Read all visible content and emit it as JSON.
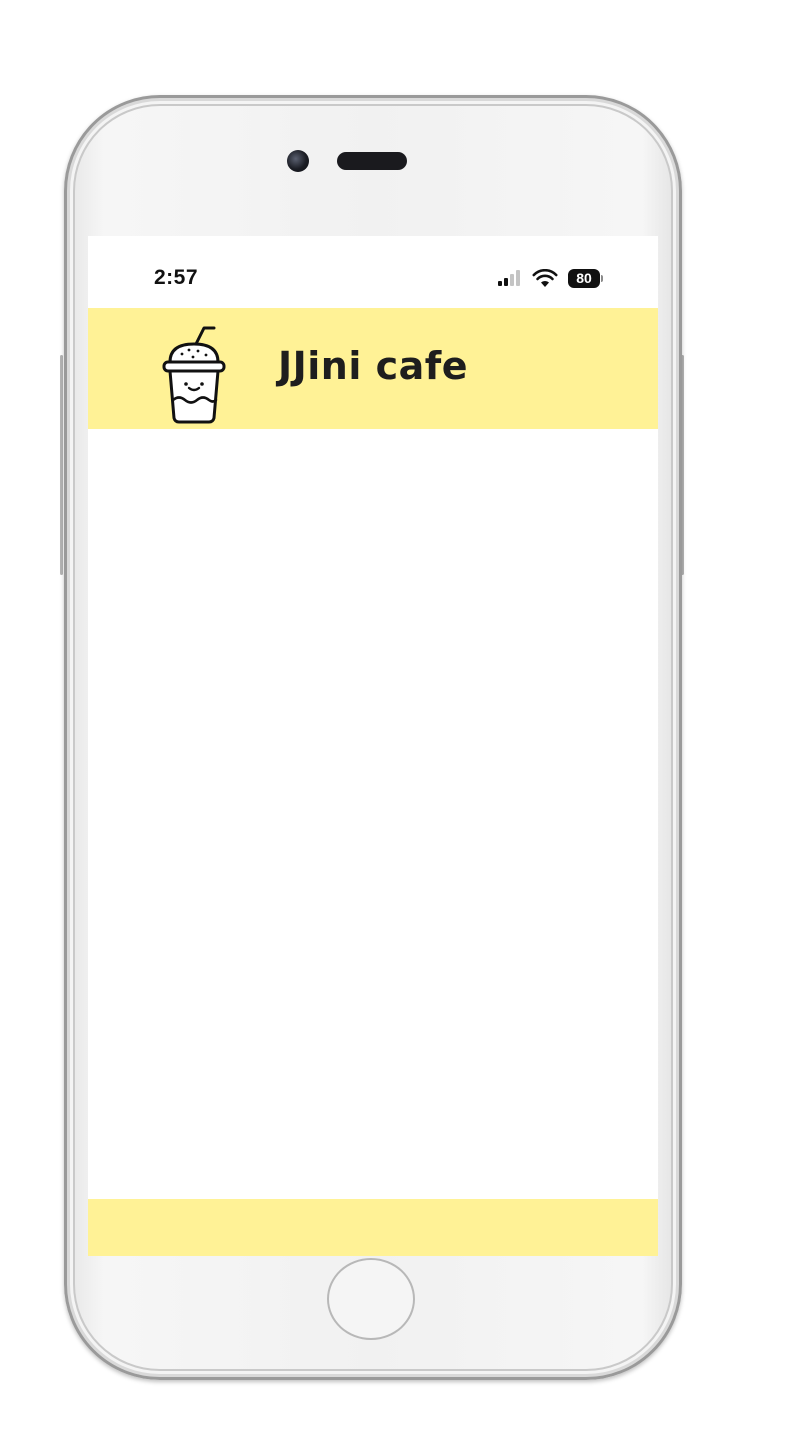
{
  "status_bar": {
    "time": "2:57",
    "battery_level": "80",
    "signal_bars_active": 2,
    "signal_bars_total": 4
  },
  "header": {
    "title": "JJini cafe",
    "logo_icon": "cafe-drink-cup-icon"
  },
  "colors": {
    "accent_yellow": "#fff296",
    "title_text": "#1e1e1e"
  }
}
